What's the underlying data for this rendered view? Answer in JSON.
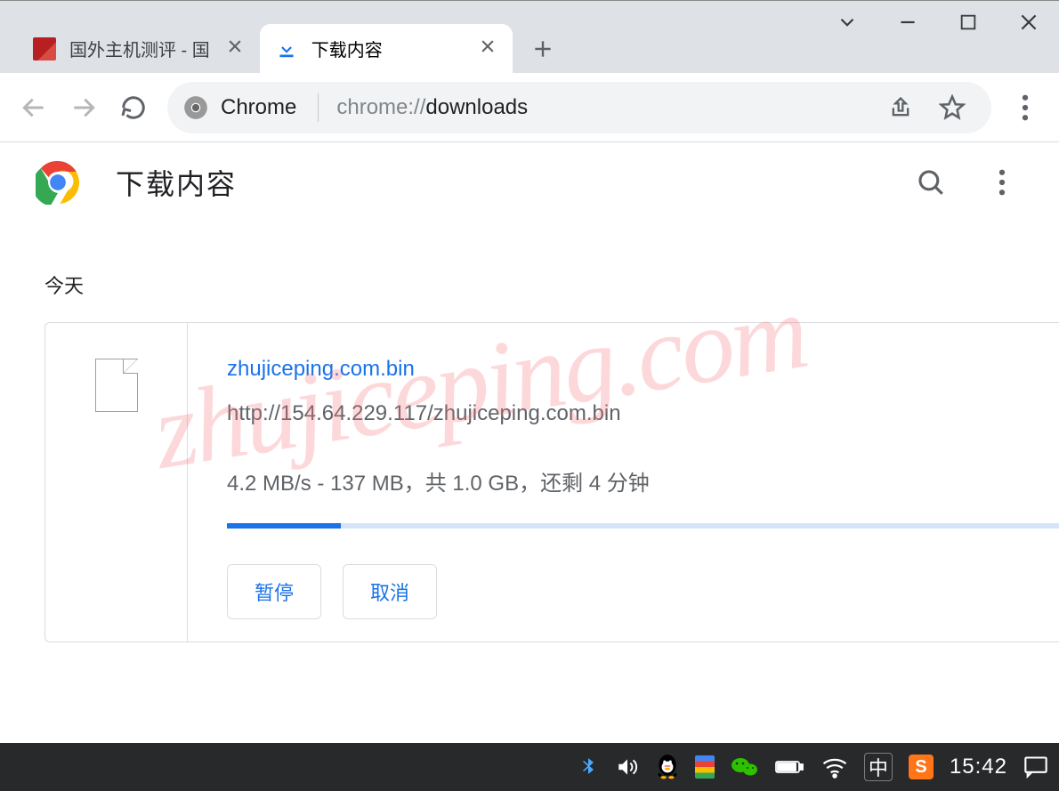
{
  "window": {
    "tabs": [
      {
        "title": "国外主机测评 - 国",
        "active": false
      },
      {
        "title": "下载内容",
        "active": true
      }
    ]
  },
  "toolbar": {
    "omnibox_label": "Chrome",
    "url_gray_prefix": "chrome://",
    "url_dark": "downloads"
  },
  "page": {
    "title": "下载内容",
    "section_today": "今天",
    "watermark": "zhujiceping.com"
  },
  "download": {
    "filename": "zhujiceping.com.bin",
    "url": "http://154.64.229.117/zhujiceping.com.bin",
    "status": "4.2 MB/s - 137 MB，共 1.0 GB，还剩 4 分钟",
    "progress_percent": 13.7,
    "buttons": {
      "pause": "暂停",
      "cancel": "取消"
    }
  },
  "taskbar": {
    "ime": "中",
    "sogou": "S",
    "time": "15:42"
  }
}
